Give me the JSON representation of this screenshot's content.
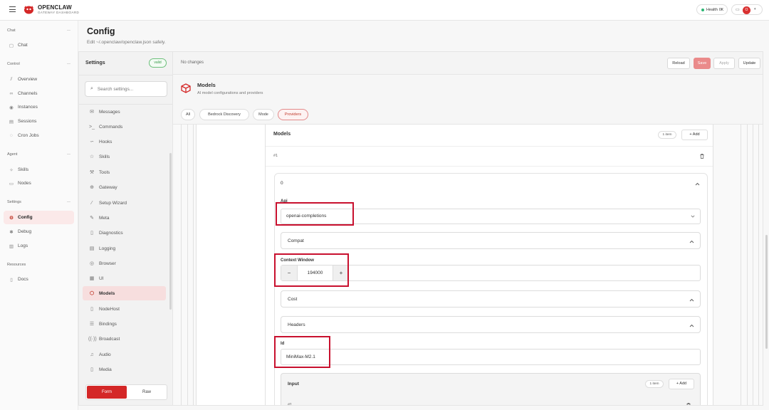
{
  "brand": {
    "title": "OPENCLAW",
    "subtitle": "GATEWAY DASHBOARD"
  },
  "topbar": {
    "health_label": "Health",
    "health_status": "OK",
    "avatar_initials": "O"
  },
  "nav": {
    "groups": [
      {
        "label": "Chat",
        "items": [
          {
            "label": "Chat",
            "icon": "chat-bubble-icon"
          }
        ]
      },
      {
        "label": "Control",
        "items": [
          {
            "label": "Overview",
            "icon": "chart-icon"
          },
          {
            "label": "Channels",
            "icon": "link-icon"
          },
          {
            "label": "Instances",
            "icon": "radio-icon"
          },
          {
            "label": "Sessions",
            "icon": "file-icon"
          },
          {
            "label": "Cron Jobs",
            "icon": "loader-icon"
          }
        ]
      },
      {
        "label": "Agent",
        "items": [
          {
            "label": "Skills",
            "icon": "sparkle-icon"
          },
          {
            "label": "Nodes",
            "icon": "monitor-icon"
          }
        ]
      },
      {
        "label": "Settings",
        "items": [
          {
            "label": "Config",
            "icon": "gear-icon"
          },
          {
            "label": "Debug",
            "icon": "bug-icon"
          },
          {
            "label": "Logs",
            "icon": "scroll-icon"
          }
        ]
      },
      {
        "label": "Resources",
        "items": [
          {
            "label": "Docs",
            "icon": "book-icon"
          }
        ]
      }
    ],
    "active": "Config"
  },
  "page": {
    "title": "Config",
    "subtitle": "Edit ~/.openclaw/openclaw.json safely."
  },
  "settings": {
    "title": "Settings",
    "badge": "valid",
    "search_placeholder": "Search settings...",
    "items": [
      {
        "label": "Messages",
        "icon": "mail-icon"
      },
      {
        "label": "Commands",
        "icon": "terminal-icon"
      },
      {
        "label": "Hooks",
        "icon": "hook-icon"
      },
      {
        "label": "Skills",
        "icon": "star-icon"
      },
      {
        "label": "Tools",
        "icon": "wrench-icon"
      },
      {
        "label": "Gateway",
        "icon": "globe-icon"
      },
      {
        "label": "Setup Wizard",
        "icon": "wand-icon"
      },
      {
        "label": "Meta",
        "icon": "pen-icon"
      },
      {
        "label": "Diagnostics",
        "icon": "document-icon"
      },
      {
        "label": "Logging",
        "icon": "list-icon"
      },
      {
        "label": "Browser",
        "icon": "browser-icon"
      },
      {
        "label": "UI",
        "icon": "layout-icon"
      },
      {
        "label": "Models",
        "icon": "cube-icon"
      },
      {
        "label": "NodeHost",
        "icon": "document-icon"
      },
      {
        "label": "Bindings",
        "icon": "stack-icon"
      },
      {
        "label": "Broadcast",
        "icon": "broadcast-icon"
      },
      {
        "label": "Audio",
        "icon": "music-icon"
      },
      {
        "label": "Media",
        "icon": "document-icon"
      }
    ],
    "active": "Models",
    "mode_form": "Form",
    "mode_raw": "Raw"
  },
  "actionbar": {
    "status": "No changes",
    "reload": "Reload",
    "save": "Save",
    "apply": "Apply",
    "update": "Update"
  },
  "section": {
    "title": "Models",
    "subtitle": "AI model configurations and providers",
    "tabs": [
      "All",
      "Bedrock Discovery",
      "Mode",
      "Providers"
    ],
    "active_tab": "Providers"
  },
  "editor": {
    "models_label": "Models",
    "models_count": "1 item",
    "add_label": "+ Add",
    "entry_index": "#1",
    "card_index": "0",
    "api_label": "Api",
    "api_value": "openai-completions",
    "compat_label": "Compat",
    "context_window_label": "Context Window",
    "context_window_value": "194000",
    "minus": "−",
    "plus": "+",
    "cost_label": "Cost",
    "headers_label": "Headers",
    "id_label": "Id",
    "id_value": "MiniMax-M2.1",
    "input_label": "Input",
    "input_count": "1 item",
    "input_add_label": "+ Add",
    "input_index": "#1"
  },
  "colors": {
    "accent": "#d42727",
    "highlight": "#c8102e",
    "valid": "#3a9b4c"
  }
}
